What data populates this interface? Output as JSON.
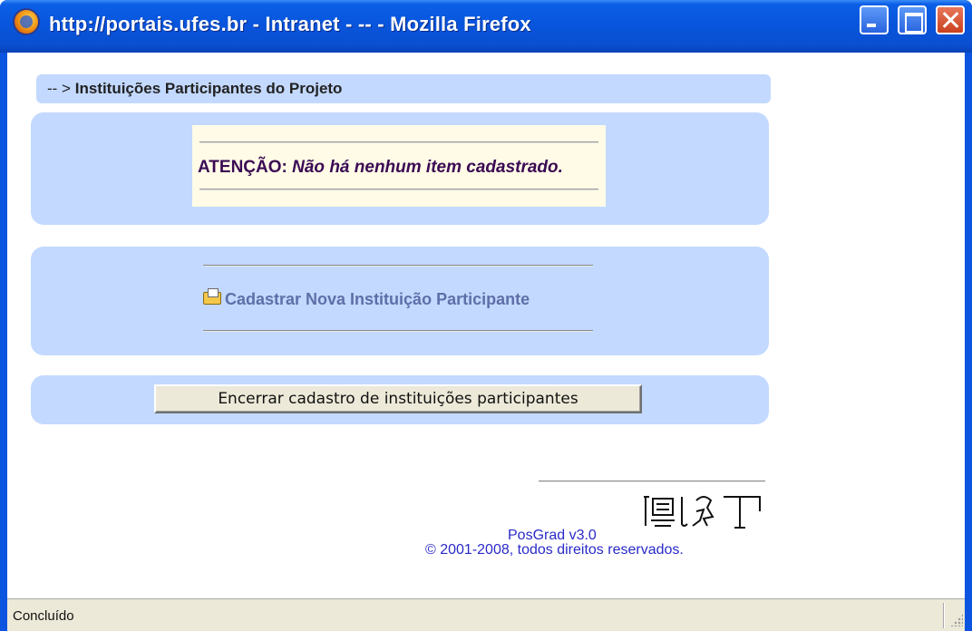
{
  "window": {
    "title": "http://portais.ufes.br - Intranet - -- - Mozilla Firefox",
    "icon": "firefox-icon",
    "controls": [
      "minimize-icon",
      "maximize-icon",
      "close-icon"
    ]
  },
  "breadcrumb": {
    "prefix": "-- >",
    "title": "Instituições Participantes do Projeto"
  },
  "notice": {
    "label": "ATENÇÃO:",
    "message": "Não há nenhum item cadastrado."
  },
  "actions": {
    "add_link": "Cadastrar Nova Instituição Participante",
    "add_icon": "folder-add-icon",
    "close_button": "Encerrar cadastro de instituições participantes"
  },
  "footer": {
    "version": "PosGrad v3.0",
    "copyright": "© 2001-2008, todos direitos reservados.",
    "logo": "hieroglyph-logo"
  },
  "statusbar": {
    "text": "Concluído"
  },
  "colors": {
    "titlebar": "#0a54e0",
    "panel": "#c3d9ff",
    "notice_bg": "#fffbe6",
    "notice_text": "#3a0a54",
    "link": "#5e6fa8",
    "footer_text": "#2a2ac8"
  }
}
